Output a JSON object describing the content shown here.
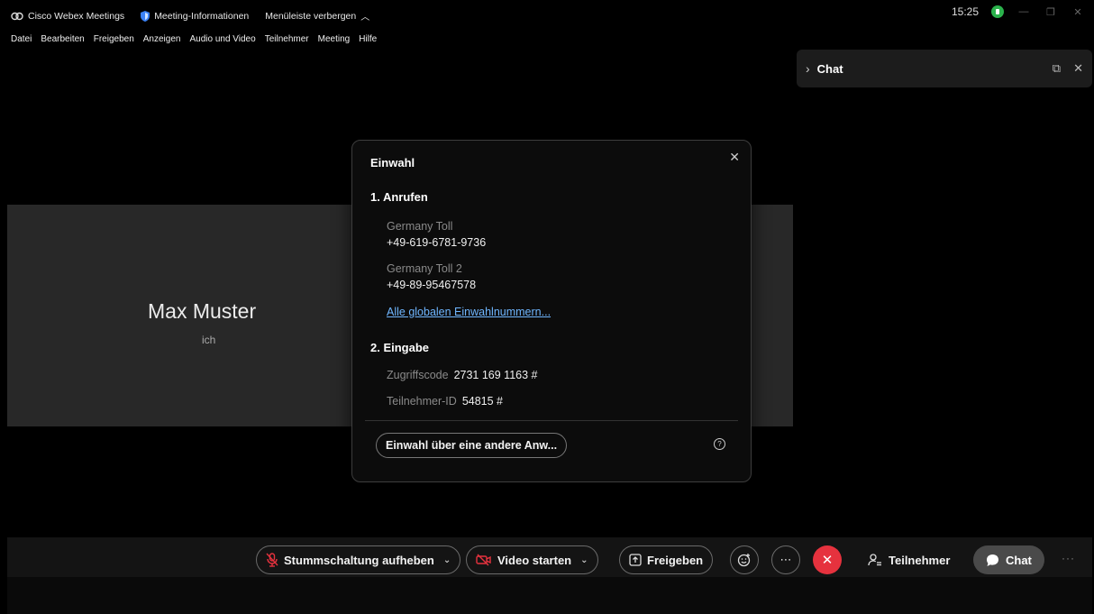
{
  "titlebar": {
    "app_name": "Cisco Webex Meetings",
    "meeting_info": "Meeting-Informationen",
    "hide_menu": "Menüleiste verbergen",
    "clock": "15:25"
  },
  "menu": [
    "Datei",
    "Bearbeiten",
    "Freigeben",
    "Anzeigen",
    "Audio und Video",
    "Teilnehmer",
    "Meeting",
    "Hilfe"
  ],
  "chat_panel": {
    "title": "Chat"
  },
  "participant": {
    "name": "Max Muster",
    "sub": "ich"
  },
  "dialog": {
    "title": "Einwahl",
    "section1": "1. Anrufen",
    "numbers": [
      {
        "label": "Germany Toll",
        "number": "+49-619-6781-9736"
      },
      {
        "label": "Germany Toll 2",
        "number": "+49-89-95467578"
      }
    ],
    "global_link": "Alle globalen Einwahlnummern...",
    "section2": "2. Eingabe",
    "access_label": "Zugriffscode",
    "access_value": "2731 169 1163 #",
    "participant_label": "Teilnehmer-ID",
    "participant_value": "54815 #",
    "alt_button": "Einwahl über eine andere Anw..."
  },
  "controls": {
    "unmute": "Stummschaltung aufheben",
    "video": "Video starten",
    "share": "Freigeben",
    "participants": "Teilnehmer",
    "chat": "Chat"
  },
  "colors": {
    "end_call": "#e6323e",
    "link": "#6fb6ff",
    "status": "#2bb24c"
  }
}
